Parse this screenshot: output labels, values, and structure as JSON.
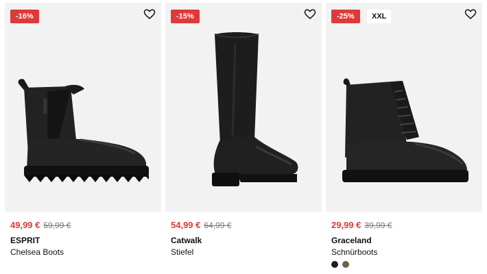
{
  "products": [
    {
      "discount": "-16%",
      "price_now": "49,99 €",
      "price_old": "59,99 €",
      "brand": "ESPRIT",
      "name": "Chelsea Boots",
      "image_icon": "chelsea-boot-image"
    },
    {
      "discount": "-15%",
      "price_now": "54,99 €",
      "price_old": "64,99 €",
      "brand": "Catwalk",
      "name": "Stiefel",
      "image_icon": "tall-boot-image"
    },
    {
      "discount": "-25%",
      "tag": "XXL",
      "price_now": "29,99 €",
      "price_old": "39,99 €",
      "brand": "Graceland",
      "name": "Schnürboots",
      "image_icon": "lace-up-boot-image",
      "color_options": [
        "#1e1e1e",
        "#6e6347"
      ]
    }
  ],
  "colors": {
    "discount_badge": "#dd3a3a",
    "sale_price": "#dd3a3a",
    "old_price": "#777777",
    "image_background": "#f2f2f2"
  },
  "icons": {
    "favorite": "heart-outline-icon"
  }
}
